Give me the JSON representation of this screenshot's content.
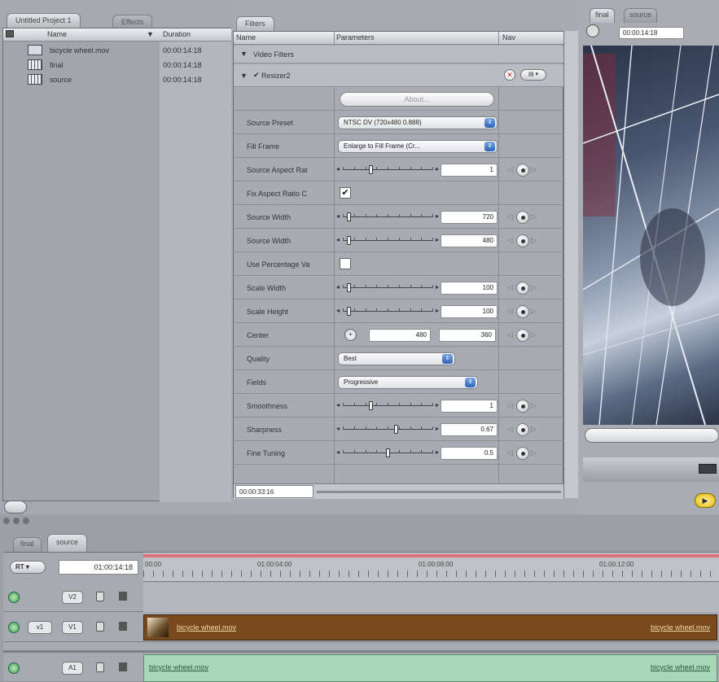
{
  "browser": {
    "tabs": [
      "Untitled Project 1",
      "Effects"
    ],
    "columns": {
      "name": "Name",
      "duration": "Duration"
    },
    "items": [
      {
        "name": "bicycle wheel.mov",
        "duration": "00:00:14:18",
        "icon": "movie-clip-icon"
      },
      {
        "name": "final",
        "duration": "00:00:14:18",
        "icon": "sequence-icon"
      },
      {
        "name": "source",
        "duration": "00:00:14:18",
        "icon": "sequence-icon"
      }
    ]
  },
  "filters": {
    "tab": "Filters",
    "columns": {
      "name": "Name",
      "parameters": "Parameters",
      "nav": "Nav"
    },
    "group": "Video Filters",
    "filter_name": "Resizer2",
    "about_label": "About...",
    "params": [
      {
        "label": "Source Preset",
        "kind": "popup",
        "value": "NTSC DV (720x480 0.888)"
      },
      {
        "label": "Fill Frame",
        "kind": "popup",
        "value": "Enlarge to Fill Frame (Cr..."
      },
      {
        "label": "Source Aspect Rat",
        "kind": "slider",
        "value": "1",
        "pos": 0.3
      },
      {
        "label": "Fix Aspect Ratio C",
        "kind": "checkbox",
        "checked": true
      },
      {
        "label": "Source Width",
        "kind": "slider",
        "value": "720",
        "pos": 0.05
      },
      {
        "label": "Source Width",
        "kind": "slider",
        "value": "480",
        "pos": 0.05
      },
      {
        "label": "Use Percentage Va",
        "kind": "checkbox",
        "checked": false
      },
      {
        "label": "Scale Width",
        "kind": "slider",
        "value": "100",
        "pos": 0.05
      },
      {
        "label": "Scale Height",
        "kind": "slider",
        "value": "100",
        "pos": 0.05
      },
      {
        "label": "Center",
        "kind": "point",
        "x": "480",
        "y": "360"
      },
      {
        "label": "Quality",
        "kind": "popup",
        "value": "Best"
      },
      {
        "label": "Fields",
        "kind": "popup",
        "value": "Progressive"
      },
      {
        "label": "Smoothness",
        "kind": "slider",
        "value": "1",
        "pos": 0.3
      },
      {
        "label": "Sharpness",
        "kind": "slider",
        "value": "0.67",
        "pos": 0.6
      },
      {
        "label": "Fine Tuning",
        "kind": "slider",
        "value": "0.5",
        "pos": 0.5
      }
    ],
    "timecode": "00:00:33:16"
  },
  "viewer": {
    "tabs": [
      "final",
      "source"
    ],
    "timecode": "00:00:14:18"
  },
  "timeline": {
    "tabs": [
      "final",
      "source"
    ],
    "rt_label": "RT",
    "timecode": "01:00:14:18",
    "ruler": [
      "00:00",
      "01:00:04:00",
      "01:00:08:00",
      "01:00:12:00"
    ],
    "tracks": [
      {
        "id": "V2",
        "patch": "",
        "clip": ""
      },
      {
        "id": "V1",
        "patch": "v1",
        "clip": "bicycle wheel.mov",
        "clip_end": "bicycle wheel.mov"
      },
      {
        "id": "A1",
        "patch": "",
        "clip": "bicycle wheel.mov",
        "clip_end": "bicycle wheel.mov"
      }
    ]
  },
  "colors": {
    "video_clip": "#7a4a1e",
    "audio_clip": "#a9d7b9",
    "ruler_in_point": "#e0707a"
  }
}
